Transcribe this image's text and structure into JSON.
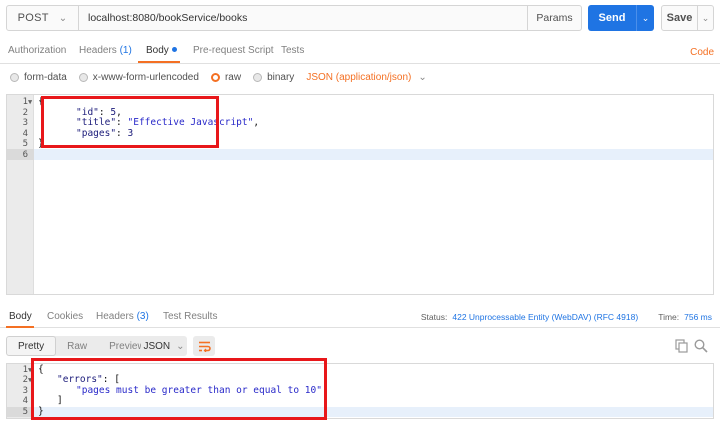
{
  "request": {
    "method": "POST",
    "url": "localhost:8080/bookService/books",
    "params_label": "Params",
    "send_label": "Send",
    "save_label": "Save"
  },
  "request_tabs": [
    {
      "label": "Authorization",
      "count": ""
    },
    {
      "label": "Headers",
      "count": "(1)"
    },
    {
      "label": "Body",
      "count": ""
    },
    {
      "label": "Pre-request Script",
      "count": ""
    },
    {
      "label": "Tests",
      "count": ""
    }
  ],
  "code_link": "Code",
  "body_types": [
    "form-data",
    "x-www-form-urlencoded",
    "raw",
    "binary"
  ],
  "selected_body_type": "raw",
  "content_type": "JSON (application/json)",
  "request_body": {
    "line_numbers": [
      "1",
      "2",
      "3",
      "4",
      "5",
      "6"
    ],
    "lines": [
      "{",
      "        \"id\": 5,",
      "        \"title\": \"Effective Javascript\",",
      "        \"pages\": 3",
      "}",
      ""
    ],
    "key_id": "\"id\"",
    "val_id": "5",
    "key_title": "\"title\"",
    "val_title": "\"Effective Javascript\"",
    "key_pages": "\"pages\"",
    "val_pages": "3"
  },
  "response_tabs": [
    {
      "label": "Body",
      "count": ""
    },
    {
      "label": "Cookies",
      "count": ""
    },
    {
      "label": "Headers",
      "count": "(3)"
    },
    {
      "label": "Test Results",
      "count": ""
    }
  ],
  "status": {
    "status_label": "Status:",
    "status_value": "422 Unprocessable Entity (WebDAV) (RFC 4918)",
    "time_label": "Time:",
    "time_value": "756 ms"
  },
  "view_modes": [
    "Pretty",
    "Raw",
    "Preview"
  ],
  "response_format": "JSON",
  "response_body": {
    "line_numbers": [
      "1",
      "2",
      "3",
      "4",
      "5"
    ],
    "key_errors": "\"errors\"",
    "error_message": "\"pages must be greater than or equal to 10\""
  },
  "colors": {
    "accent": "#f47023",
    "primary": "#1f74e3",
    "highlight_box": "#e8171a"
  }
}
